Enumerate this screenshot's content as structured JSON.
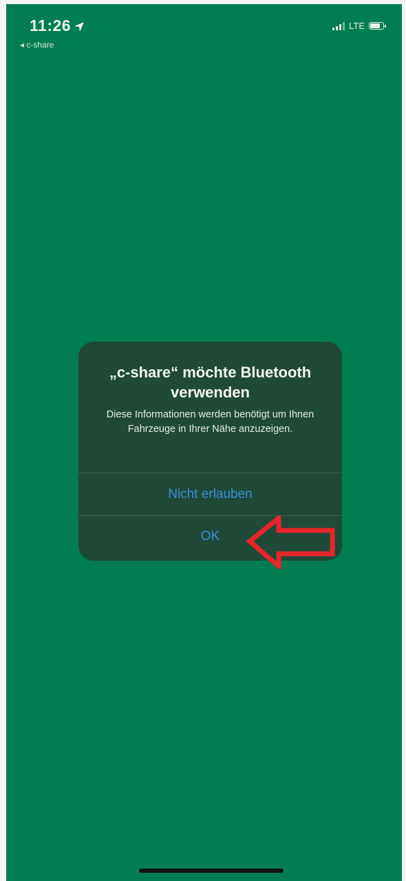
{
  "status_bar": {
    "time": "11:26",
    "back_app": "◂ c-share",
    "network": "LTE",
    "battery_level": 0.75
  },
  "alert": {
    "title": "„c-share“ möchte Bluetooth verwenden",
    "message": "Diese Informationen werden benötigt um Ihnen Fahrzeuge in Ihrer Nähe anzuzeigen.",
    "deny_label": "Nicht erlauben",
    "ok_label": "OK"
  },
  "colors": {
    "background": "#007d51",
    "alert_bg": "#1f4a38",
    "button_text": "#3d8fd8",
    "annotation_arrow": "#e8252a"
  },
  "icons": {
    "location": "location-arrow-icon",
    "signal": "cellular-signal-icon",
    "battery": "battery-icon",
    "annotation": "red-arrow-icon"
  }
}
